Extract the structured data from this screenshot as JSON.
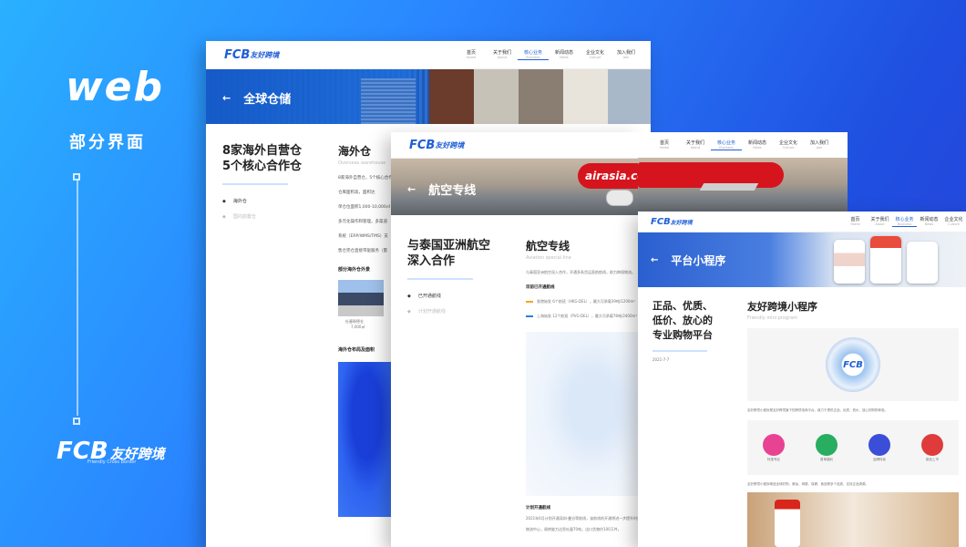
{
  "left": {
    "title": "web",
    "subtitle": "部分界面",
    "logo_fcb": "FCB",
    "logo_cn": "友好跨境",
    "logo_en": "Friendly Cross Border"
  },
  "brand": {
    "fcb": "FCB",
    "cn": "友好跨境"
  },
  "panel1": {
    "menu": [
      {
        "cn": "首页",
        "en": "Home"
      },
      {
        "cn": "关于我们",
        "en": "About"
      },
      {
        "cn": "核心业务",
        "en": "Business"
      },
      {
        "cn": "新闻动态",
        "en": "News"
      },
      {
        "cn": "企业文化",
        "en": "Culture"
      },
      {
        "cn": "加入我们",
        "en": "Join"
      }
    ],
    "banner_title": "全球仓储",
    "left_h1": "8家海外自营仓",
    "left_h2": "5个核心合作仓",
    "side_items": [
      "海外仓",
      "国内前置仓"
    ],
    "section_title": "海外仓",
    "section_en": "Overseas warehouse",
    "bullets": [
      "8家海外自营仓，5个核心合作仓",
      "仓库面积高，面积达",
      "单仓位面积1,000-10,000㎡",
      "多元化操作和管理，多渠道",
      "系统（ERP/WMS/TMS）支",
      "售仓完仓直接带驱服务（量"
    ],
    "sub_heading": "部分海外仓外景",
    "wh_caption1": "杜塞释德仓",
    "wh_caption2": "7,000㎡",
    "map_heading": "海外仓布局及面积"
  },
  "panel2": {
    "menu": [
      {
        "cn": "首页",
        "en": "Home"
      },
      {
        "cn": "关于我们",
        "en": "About"
      },
      {
        "cn": "核心业务",
        "en": "Business"
      },
      {
        "cn": "新闻动态",
        "en": "News"
      },
      {
        "cn": "企业文化",
        "en": "Culture"
      },
      {
        "cn": "加入我们",
        "en": "Join"
      }
    ],
    "banner_title": "航空专线",
    "plane_text": "airasia.com",
    "left_h1": "与泰国亚洲航空",
    "left_h2": "深入合作",
    "side_items": [
      "已开通航线",
      "计划开通航线"
    ],
    "section_title": "航空专线",
    "section_en": "Aviation special line",
    "intro": "与泰国亚洲航空深入合作，开通多条货运直航航线，助力跨境物流。",
    "routes_heading": "目前已开通航线",
    "route1": "香港始发 6个航班（HKG-DEL），最大可承载39吨/1200m³",
    "route2": "上海始发 12个航班（PVG-DEL），最大可承载78吨/2400m³",
    "plan_heading": "计划开通航线",
    "plan_text1": "2021年6月计划开通深圳-曼谷等航线，该航线的开通将进一步提升时效",
    "plan_text2": "物流中心，周转能力达吞吐量70吨，出口货物约100万件。",
    "route1_color": "#f5a623",
    "route2_color": "#2a7de1"
  },
  "panel3": {
    "menu": [
      {
        "cn": "首页",
        "en": "Home"
      },
      {
        "cn": "关于我们",
        "en": "About"
      },
      {
        "cn": "核心业务",
        "en": "Business"
      },
      {
        "cn": "新闻动态",
        "en": "News"
      },
      {
        "cn": "企业文化",
        "en": "Culture"
      }
    ],
    "banner_title": "平台小程序",
    "left_lines": [
      "正品、优质、",
      "低价、放心的",
      "专业购物平台"
    ],
    "date": "2021-7-7",
    "section_title": "友好跨境小程序",
    "section_en": "Friendly mini program",
    "qr_label": "FCB",
    "desc1": "友好跨境小程序是友好跨境旗下的跨境电商平台，致力于提供正品、优质、低价、放心的购物体验。",
    "icons": [
      {
        "label": "特惠专区",
        "color": "#e84393"
      },
      {
        "label": "首单福利",
        "color": "#27ae60"
      },
      {
        "label": "品牌特卖",
        "color": "#3b4ed8"
      },
      {
        "label": "新品上市",
        "color": "#e03b3b"
      }
    ],
    "desc2": "友好跨境小程序精选全球好物，美妆、母婴、保健、食品等多个品类，支持正品溯源。"
  }
}
